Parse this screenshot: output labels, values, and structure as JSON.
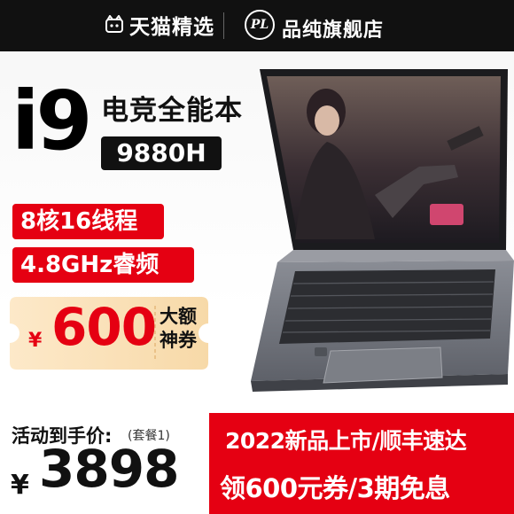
{
  "header": {
    "platform_name": "天猫精选",
    "shop_logo_text": "PL",
    "shop_name": "品纯旗舰店"
  },
  "product": {
    "cpu_tier": "i9",
    "headline": "电竞全能本",
    "cpu_model": "9880H",
    "feature_1": "8核16线程",
    "feature_2": "4.8GHz睿频"
  },
  "coupon": {
    "currency": "¥",
    "amount": "600",
    "label_line_1": "大额",
    "label_line_2": "神券"
  },
  "price": {
    "label": "活动到手价:",
    "note": "(套餐1)",
    "currency": "¥",
    "value": "3898"
  },
  "promo": {
    "line_1": "2022新品上市/顺丰速达",
    "line_2": "领600元券/3期免息"
  },
  "colors": {
    "accent_red": "#e50012",
    "header_black": "#111111",
    "coupon_bg": "#fbe7c4"
  },
  "icons": {
    "platform_logo": "tmall-cat-icon",
    "shop_logo": "pl-circle-logo"
  }
}
